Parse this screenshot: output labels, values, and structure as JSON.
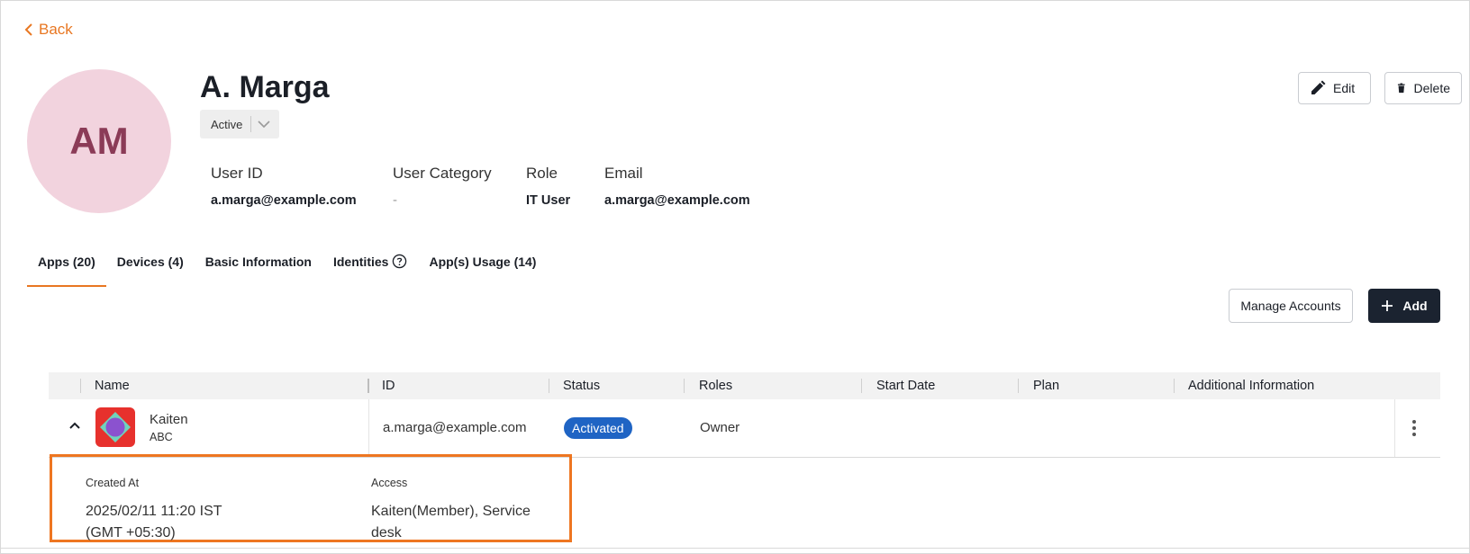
{
  "nav": {
    "back_label": "Back"
  },
  "user": {
    "initials": "AM",
    "name": "A. Marga",
    "status": "Active",
    "avatar_color": "#f2d3de",
    "initials_color": "#8b3b57"
  },
  "info": [
    {
      "label": "User ID",
      "value": "a.marga@example.com"
    },
    {
      "label": "User Category",
      "value": "-"
    },
    {
      "label": "Role",
      "value": "IT User"
    },
    {
      "label": "Email",
      "value": "a.marga@example.com"
    }
  ],
  "actions": {
    "edit_label": "Edit",
    "delete_label": "Delete"
  },
  "tabs": [
    {
      "label": "Apps (20)",
      "active": true
    },
    {
      "label": "Devices (4)"
    },
    {
      "label": "Basic Information"
    },
    {
      "label": "Identities",
      "icon": "help-circle-icon"
    },
    {
      "label": "App(s) Usage (14)"
    }
  ],
  "toolbar": {
    "manage_accounts_label": "Manage Accounts",
    "add_label": "Add"
  },
  "table": {
    "columns": [
      "Name",
      "ID",
      "Status",
      "Roles",
      "Start Date",
      "Plan",
      "Additional Information"
    ],
    "rows": [
      {
        "app_name": "Kaiten",
        "app_org": "ABC",
        "id": "a.marga@example.com",
        "status": "Activated",
        "roles": "Owner",
        "start_date": "",
        "plan": "",
        "additional_info": "",
        "expanded": true,
        "details": {
          "created_at_label": "Created At",
          "created_at_value": "2025/02/11 11:20 IST (GMT +05:30)",
          "access_label": "Access",
          "access_value": "Kaiten(Member), Service desk"
        }
      }
    ]
  },
  "colors": {
    "accent": "#e87722",
    "primary_dark": "#1b2330",
    "status_activated": "#1f64c4",
    "highlight_border": "#ee7621"
  }
}
